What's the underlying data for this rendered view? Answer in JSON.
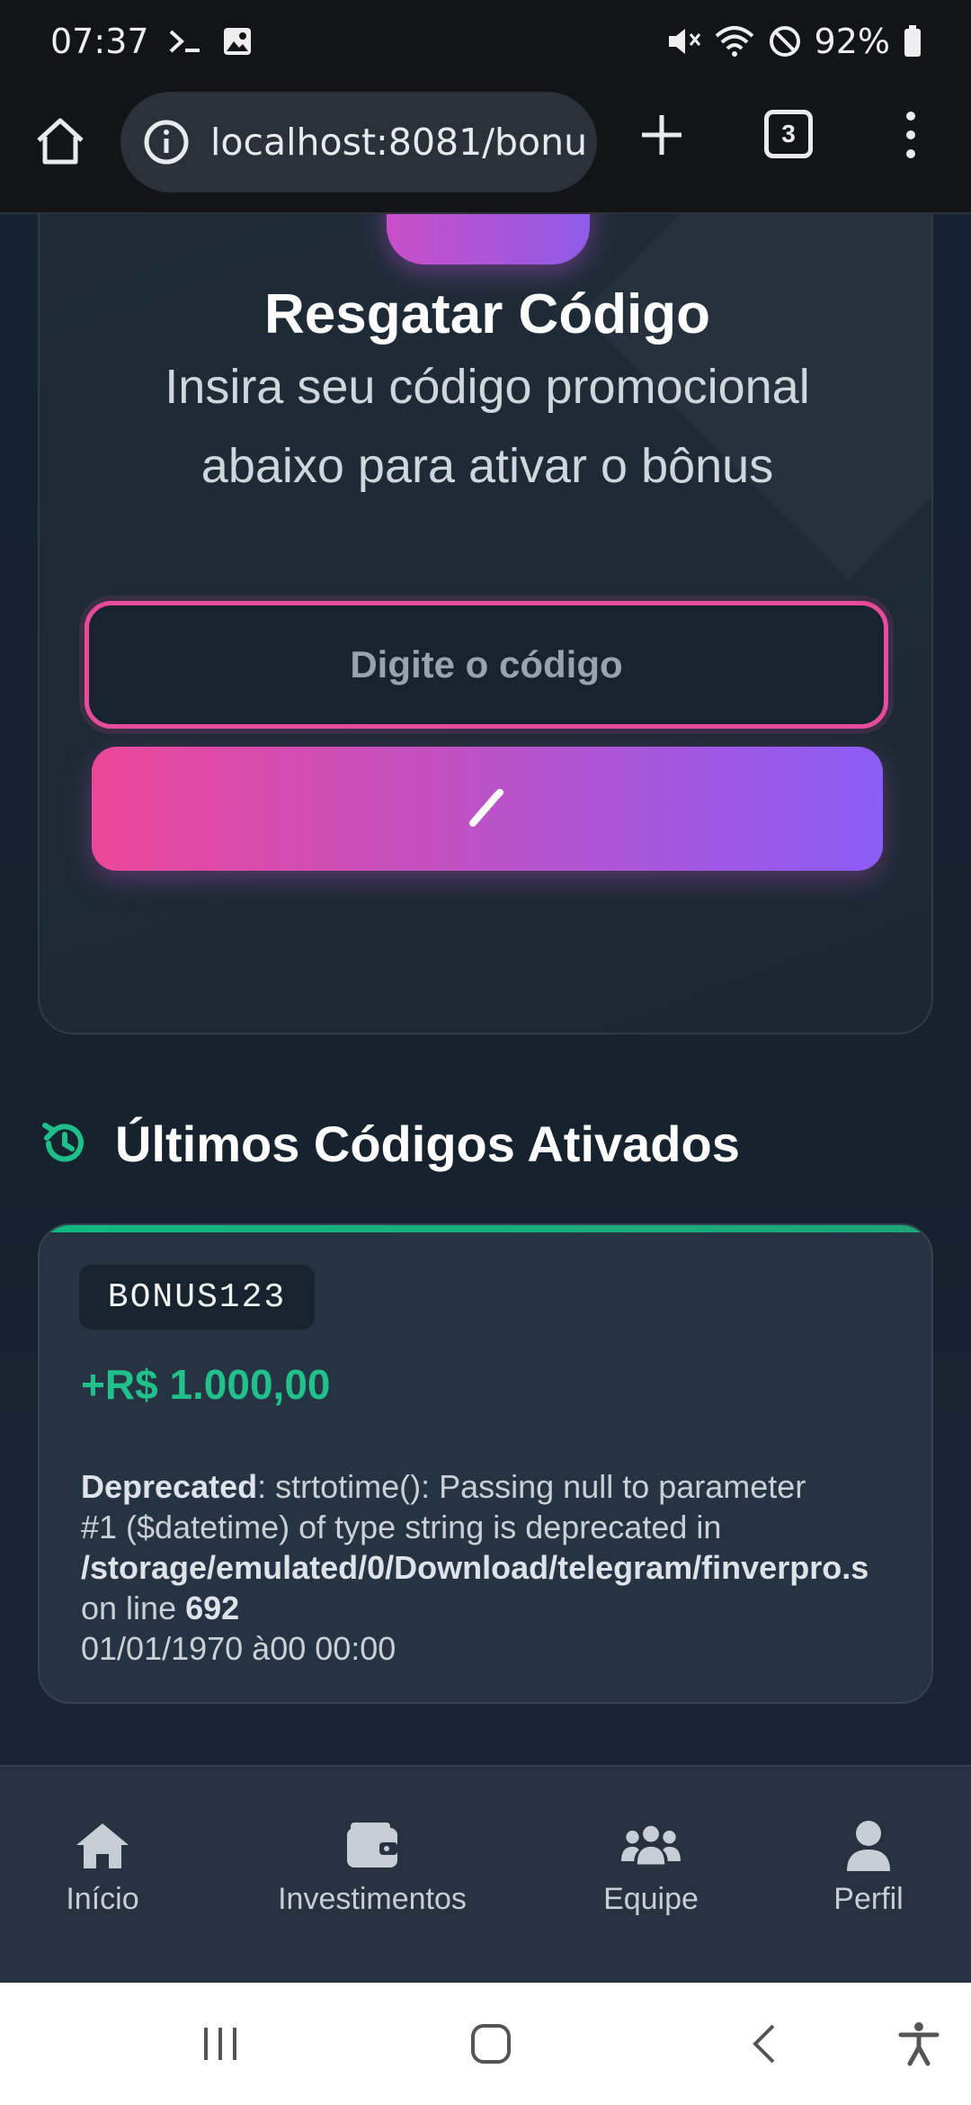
{
  "status_bar": {
    "time": "07:37",
    "battery": "92%"
  },
  "browser": {
    "url": "localhost:8081/bonu",
    "tab_count": "3"
  },
  "redeem": {
    "title": "Resgatar Código",
    "subtitle": "Insira seu código promocional abaixo para ativar o bônus",
    "input_placeholder": "Digite o código",
    "button_icon": "pencil-icon"
  },
  "recent": {
    "title": "Últimos Códigos Ativados",
    "icon": "history-icon",
    "items": [
      {
        "code": "BONUS123",
        "amount": "+R$ 1.000,00",
        "warning_label": "Deprecated",
        "warning_line1": ": strtotime(): Passing null to parameter",
        "warning_line2": "#1 ($datetime) of type string is deprecated in",
        "warning_path": "/storage/emulated/0/Download/telegram/finverpro.s",
        "warning_line_prefix": "on line ",
        "warning_line_number": "692",
        "date": "01/01/1970 à00 00:00"
      }
    ]
  },
  "bottom_nav": {
    "items": [
      {
        "label": "Início",
        "icon": "home-icon"
      },
      {
        "label": "Investimentos",
        "icon": "wallet-icon"
      },
      {
        "label": "Equipe",
        "icon": "users-icon"
      },
      {
        "label": "Perfil",
        "icon": "user-icon"
      }
    ]
  },
  "colors": {
    "accent_pink": "#ec4899",
    "accent_purple": "#8b5cf6",
    "success_green": "#22c08a",
    "background": "#152330"
  }
}
